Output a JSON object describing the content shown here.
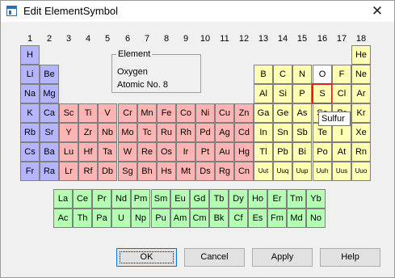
{
  "window": {
    "title": "Edit ElementSymbol",
    "close_glyph": "✕"
  },
  "groups": [
    "1",
    "2",
    "3",
    "4",
    "5",
    "6",
    "7",
    "8",
    "9",
    "10",
    "11",
    "12",
    "13",
    "14",
    "15",
    "16",
    "17",
    "18"
  ],
  "element_info": {
    "group_label": "Element",
    "name": "Oxygen",
    "atomic_no": "Atomic No. 8"
  },
  "tooltip": "Sulfur",
  "selected_symbol": "S",
  "colors": {
    "s_block": "#b4b4ff",
    "d_block": "#ffb4b4",
    "p_block": "#ffffb4",
    "f_block": "#b4ffb4",
    "selection": "#e0201b"
  },
  "rows": [
    [
      [
        "H",
        1,
        "blue"
      ],
      [
        "He",
        18,
        "yel"
      ]
    ],
    [
      [
        "Li",
        1,
        "blue"
      ],
      [
        "Be",
        2,
        "blue"
      ],
      [
        "B",
        13,
        "yel"
      ],
      [
        "C",
        14,
        "yel"
      ],
      [
        "N",
        15,
        "yel"
      ],
      [
        "O",
        16,
        "white"
      ],
      [
        "F",
        17,
        "yel"
      ],
      [
        "Ne",
        18,
        "yel"
      ]
    ],
    [
      [
        "Na",
        1,
        "blue"
      ],
      [
        "Mg",
        2,
        "blue"
      ],
      [
        "Al",
        13,
        "yel"
      ],
      [
        "Si",
        14,
        "yel"
      ],
      [
        "P",
        15,
        "yel"
      ],
      [
        "S",
        16,
        "yel"
      ],
      [
        "Cl",
        17,
        "yel"
      ],
      [
        "Ar",
        18,
        "yel"
      ]
    ],
    [
      [
        "K",
        1,
        "blue"
      ],
      [
        "Ca",
        2,
        "blue"
      ],
      [
        "Sc",
        3,
        "red"
      ],
      [
        "Ti",
        4,
        "red"
      ],
      [
        "V",
        5,
        "red"
      ],
      [
        "Cr",
        6,
        "red"
      ],
      [
        "Mn",
        7,
        "red"
      ],
      [
        "Fe",
        8,
        "red"
      ],
      [
        "Co",
        9,
        "red"
      ],
      [
        "Ni",
        10,
        "red"
      ],
      [
        "Cu",
        11,
        "red"
      ],
      [
        "Zn",
        12,
        "red"
      ],
      [
        "Ga",
        13,
        "yel"
      ],
      [
        "Ge",
        14,
        "yel"
      ],
      [
        "As",
        15,
        "yel"
      ],
      [
        "Se",
        16,
        "yel"
      ],
      [
        "Br",
        17,
        "yel"
      ],
      [
        "Kr",
        18,
        "yel"
      ]
    ],
    [
      [
        "Rb",
        1,
        "blue"
      ],
      [
        "Sr",
        2,
        "blue"
      ],
      [
        "Y",
        3,
        "red"
      ],
      [
        "Zr",
        4,
        "red"
      ],
      [
        "Nb",
        5,
        "red"
      ],
      [
        "Mo",
        6,
        "red"
      ],
      [
        "Tc",
        7,
        "red"
      ],
      [
        "Ru",
        8,
        "red"
      ],
      [
        "Rh",
        9,
        "red"
      ],
      [
        "Pd",
        10,
        "red"
      ],
      [
        "Ag",
        11,
        "red"
      ],
      [
        "Cd",
        12,
        "red"
      ],
      [
        "In",
        13,
        "yel"
      ],
      [
        "Sn",
        14,
        "yel"
      ],
      [
        "Sb",
        15,
        "yel"
      ],
      [
        "Te",
        16,
        "yel"
      ],
      [
        "I",
        17,
        "yel"
      ],
      [
        "Xe",
        18,
        "yel"
      ]
    ],
    [
      [
        "Cs",
        1,
        "blue"
      ],
      [
        "Ba",
        2,
        "blue"
      ],
      [
        "Lu",
        3,
        "red"
      ],
      [
        "Hf",
        4,
        "red"
      ],
      [
        "Ta",
        5,
        "red"
      ],
      [
        "W",
        6,
        "red"
      ],
      [
        "Re",
        7,
        "red"
      ],
      [
        "Os",
        8,
        "red"
      ],
      [
        "Ir",
        9,
        "red"
      ],
      [
        "Pt",
        10,
        "red"
      ],
      [
        "Au",
        11,
        "red"
      ],
      [
        "Hg",
        12,
        "red"
      ],
      [
        "Tl",
        13,
        "yel"
      ],
      [
        "Pb",
        14,
        "yel"
      ],
      [
        "Bi",
        15,
        "yel"
      ],
      [
        "Po",
        16,
        "yel"
      ],
      [
        "At",
        17,
        "yel"
      ],
      [
        "Rn",
        18,
        "yel"
      ]
    ],
    [
      [
        "Fr",
        1,
        "blue"
      ],
      [
        "Ra",
        2,
        "blue"
      ],
      [
        "Lr",
        3,
        "red"
      ],
      [
        "Rf",
        4,
        "red"
      ],
      [
        "Db",
        5,
        "red"
      ],
      [
        "Sg",
        6,
        "red"
      ],
      [
        "Bh",
        7,
        "red"
      ],
      [
        "Hs",
        8,
        "red"
      ],
      [
        "Mt",
        9,
        "red"
      ],
      [
        "Ds",
        10,
        "red"
      ],
      [
        "Rg",
        11,
        "red"
      ],
      [
        "Cn",
        12,
        "red"
      ],
      [
        "Uut",
        13,
        "yel"
      ],
      [
        "Uuq",
        14,
        "yel"
      ],
      [
        "Uup",
        15,
        "yel"
      ],
      [
        "Uuh",
        16,
        "yel"
      ],
      [
        "Uus",
        17,
        "yel"
      ],
      [
        "Uuo",
        18,
        "yel"
      ]
    ]
  ],
  "lanthanides": [
    "La",
    "Ce",
    "Pr",
    "Nd",
    "Pm",
    "Sm",
    "Eu",
    "Gd",
    "Tb",
    "Dy",
    "Ho",
    "Er",
    "Tm",
    "Yb"
  ],
  "actinides": [
    "Ac",
    "Th",
    "Pa",
    "U",
    "Np",
    "Pu",
    "Am",
    "Cm",
    "Bk",
    "Cf",
    "Es",
    "Fm",
    "Md",
    "No"
  ],
  "buttons": {
    "ok": "OK",
    "cancel": "Cancel",
    "apply": "Apply",
    "help": "Help"
  }
}
